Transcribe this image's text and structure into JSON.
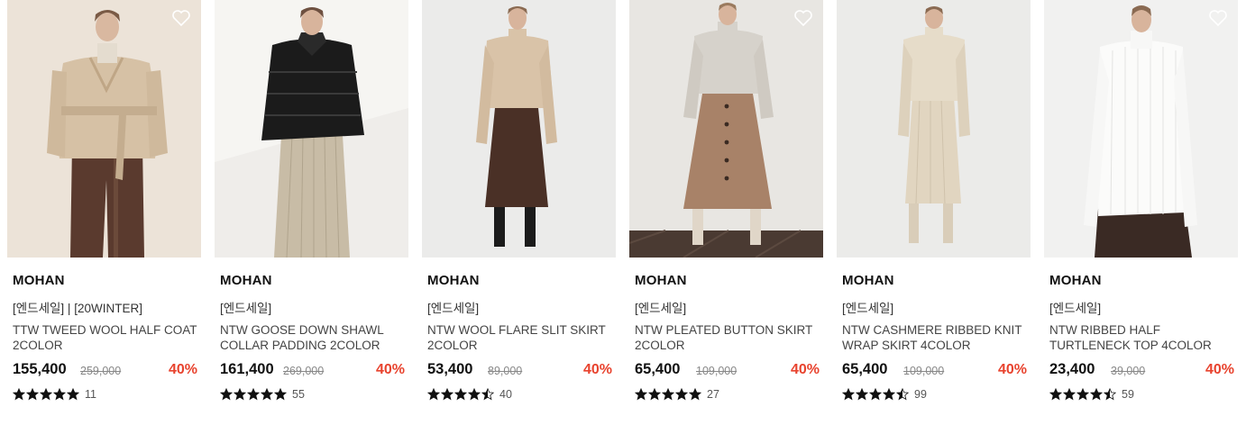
{
  "products": [
    {
      "brand": "MOHAN",
      "tag": "[엔드세일] | [20WINTER]",
      "title": "TTW TWEED WOOL HALF COAT 2COLOR",
      "price": "155,400",
      "original_price": "259,000",
      "discount": "40%",
      "rating": 5,
      "review_count": "11",
      "image": "woman-beige-wool-half-coat-brown-pants",
      "bg": "#e6ddd0"
    },
    {
      "brand": "MOHAN",
      "tag": "[엔드세일]",
      "title": "NTW GOOSE DOWN SHAWL COLLAR PADDING 2COLOR",
      "price": "161,400",
      "original_price": "269,000",
      "discount": "40%",
      "rating": 5,
      "review_count": "55",
      "image": "woman-black-puffer-jacket-pleated-skirt",
      "bg": "#efeeec"
    },
    {
      "brand": "MOHAN",
      "tag": "[엔드세일]",
      "title": "NTW WOOL FLARE SLIT SKIRT 2COLOR",
      "price": "53,400",
      "original_price": "89,000",
      "discount": "40%",
      "rating": 4.5,
      "review_count": "40",
      "image": "woman-beige-sweater-brown-flare-skirt",
      "bg": "#ececec"
    },
    {
      "brand": "MOHAN",
      "tag": "[엔드세일]",
      "title": "NTW PLEATED BUTTON SKIRT 2COLOR",
      "price": "65,400",
      "original_price": "109,000",
      "discount": "40%",
      "rating": 5,
      "review_count": "27",
      "image": "woman-grey-knit-camel-button-skirt",
      "bg": "#e9e6e1"
    },
    {
      "brand": "MOHAN",
      "tag": "[엔드세일]",
      "title": "NTW CASHMERE RIBBED KNIT WRAP SKIRT 4COLOR",
      "price": "65,400",
      "original_price": "109,000",
      "discount": "40%",
      "rating": 4.5,
      "review_count": "99",
      "image": "woman-cream-ribbed-knit-set",
      "bg": "#ececea"
    },
    {
      "brand": "MOHAN",
      "tag": "[엔드세일]",
      "title": "NTW RIBBED HALF TURTLENECK TOP 4COLOR",
      "price": "23,400",
      "original_price": "39,000",
      "discount": "40%",
      "rating": 4.5,
      "review_count": "59",
      "image": "woman-white-ribbed-turtleneck-top",
      "bg": "#f1f1f1"
    }
  ],
  "icons": {
    "wishlist": "heart-outline-icon",
    "star": "star-icon"
  },
  "colors": {
    "discount": "#e8432e",
    "text": "#222222",
    "strike": "#888888"
  }
}
